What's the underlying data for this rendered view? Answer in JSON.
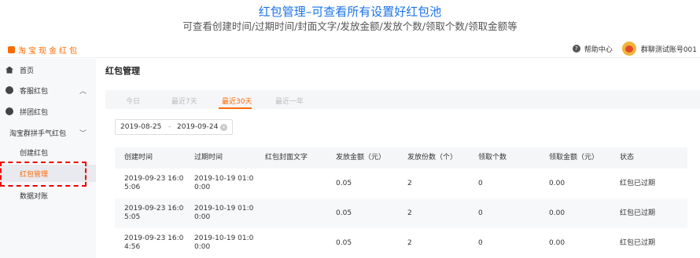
{
  "caption": {
    "title": "红包管理–可查看所有设置好红包池",
    "subtitle": "可查看创建时间/过期时间/封面文字/发放金额/发放个数/领取个数/领取金额等"
  },
  "topbar": {
    "brand": "淘宝现金红包",
    "help": "帮助中心",
    "account": "群聊测试账号001"
  },
  "sidebar": {
    "items": [
      {
        "label": "首页"
      },
      {
        "label": "客服红包"
      },
      {
        "label": "拼团红包"
      },
      {
        "label": "淘宝群拼手气红包"
      },
      {
        "label": "创建红包"
      },
      {
        "label": "红包管理"
      },
      {
        "label": "数据对账"
      }
    ]
  },
  "main": {
    "title": "红包管理",
    "tabs": [
      "今日",
      "最近7天",
      "最近30天",
      "最近一年"
    ],
    "active_tab": "最近30天",
    "date_range": {
      "start": "2019-08-25",
      "separator": "-",
      "end": "2019-09-24"
    },
    "table": {
      "headers": [
        "创建时间",
        "过期时间",
        "红包封面文字",
        "发放金额（元）",
        "发放份数（个）",
        "领取个数",
        "领取金额（元）",
        "状态"
      ],
      "rows": [
        {
          "created": [
            "2019-09-23 16:0",
            "5:06"
          ],
          "expires": [
            "2019-10-19 01:0",
            "0:00"
          ],
          "cover": "",
          "amount": "0.05",
          "count": "2",
          "received": "0",
          "received_amount": "0.00",
          "status": "红包已过期"
        },
        {
          "created": [
            "2019-09-23 16:0",
            "5:05"
          ],
          "expires": [
            "2019-10-19 01:0",
            "0:00"
          ],
          "cover": "",
          "amount": "0.05",
          "count": "2",
          "received": "0",
          "received_amount": "0.00",
          "status": "红包已过期"
        },
        {
          "created": [
            "2019-09-23 16:0",
            "4:56"
          ],
          "expires": [
            "2019-10-19 01:0",
            "0:00"
          ],
          "cover": "",
          "amount": "0.05",
          "count": "2",
          "received": "0",
          "received_amount": "0.00",
          "status": "红包已过期"
        }
      ]
    }
  },
  "colors": {
    "accent": "#ff6a00",
    "caption": "#1a73e8",
    "highlight": "#e00000"
  }
}
